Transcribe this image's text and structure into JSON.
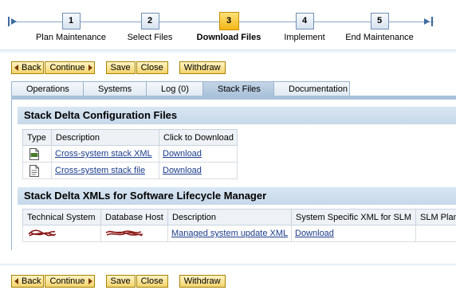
{
  "roadmap": {
    "steps": [
      {
        "number": "1",
        "label": "Plan Maintenance"
      },
      {
        "number": "2",
        "label": "Select Files"
      },
      {
        "number": "3",
        "label": "Download Files"
      },
      {
        "number": "4",
        "label": "Implement"
      },
      {
        "number": "5",
        "label": "End Maintenance"
      }
    ],
    "active_step": "3"
  },
  "toolbar": {
    "back_label": "Back",
    "continue_label": "Continue",
    "save_label": "Save",
    "close_label": "Close",
    "withdraw_label": "Withdraw"
  },
  "tabs": [
    {
      "label": "Operations"
    },
    {
      "label": "Systems"
    },
    {
      "label": "Log (0)"
    },
    {
      "label": "Stack Files",
      "active": true
    },
    {
      "label": "Documentation"
    }
  ],
  "stack_config": {
    "title": "Stack Delta Configuration Files",
    "columns": [
      "Type",
      "Description",
      "Click to Download"
    ],
    "rows": [
      {
        "type_icon": "xml-file-icon",
        "description": "Cross-system stack XML",
        "download": "Download"
      },
      {
        "type_icon": "text-file-icon",
        "description": "Cross-system stack file",
        "download": "Download"
      }
    ]
  },
  "slm": {
    "title": "Stack Delta XMLs for Software Lifecycle Manager",
    "columns": [
      "Technical System",
      "Database Host",
      "Description",
      "System Specific XML for SLM",
      "SLM Plan"
    ],
    "rows": [
      {
        "technical_system": "",
        "database_host": "",
        "description": "Managed system update XML",
        "xml": "Download",
        "slm_plan": ""
      }
    ]
  },
  "colors": {
    "accent": "#f4b616",
    "link": "#1b3c8c",
    "redaction": "#8b1a1a"
  }
}
